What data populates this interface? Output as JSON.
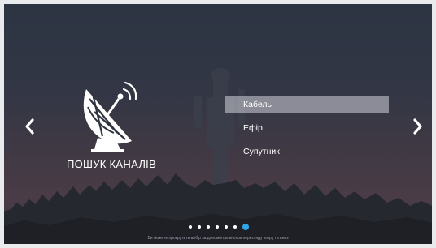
{
  "nav": {
    "prev_arrow": "‹",
    "next_arrow": "›"
  },
  "title": "ПОШУК КАНАЛІВ",
  "options": [
    {
      "label": "Кабель",
      "selected": true
    },
    {
      "label": "Ефір",
      "selected": false
    },
    {
      "label": "Супутник",
      "selected": false
    }
  ],
  "pagination": {
    "total": 7,
    "active_index": 6
  },
  "hint": "Ви можете прокрутити вибір за допомогою кнопок перегляду вгору та вниз",
  "colors": {
    "accent": "#2ea6e6",
    "selection": "#c8cad0",
    "text": "#ffffff"
  },
  "icons": {
    "dish": "satellite-dish-icon",
    "left": "chevron-left-icon",
    "right": "chevron-right-icon"
  }
}
